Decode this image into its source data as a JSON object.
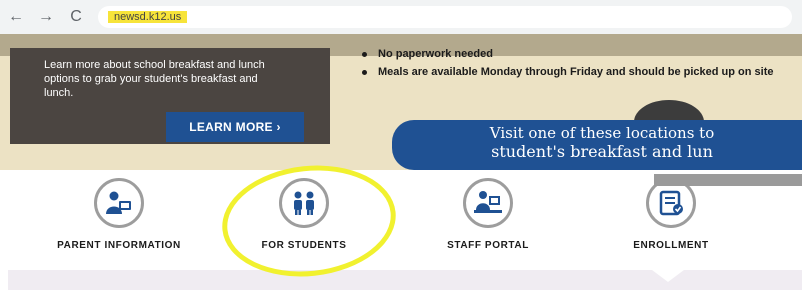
{
  "browser": {
    "back": "←",
    "forward": "→",
    "reload": "C",
    "url": "newsd.k12.us"
  },
  "hero": {
    "left_text": "Learn more about school breakfast and lunch options to grab your student's breakfast and lunch.",
    "learn_more": "LEARN MORE ›",
    "bullets": [
      "No paperwork needed",
      "Meals are available Monday through Friday and should be picked up on site"
    ],
    "banner_line1": "Visit one of these locations to",
    "banner_line2": "student's breakfast and lun"
  },
  "quick_links": [
    {
      "label": "PARENT INFORMATION",
      "icon": "parent-icon"
    },
    {
      "label": "FOR STUDENTS",
      "icon": "students-icon"
    },
    {
      "label": "STAFF PORTAL",
      "icon": "staff-icon"
    },
    {
      "label": "ENROLLMENT",
      "icon": "enrollment-icon"
    }
  ],
  "colors": {
    "navy": "#1f5193",
    "highlight": "#f1f12f",
    "dark_box": "#4b4541"
  }
}
